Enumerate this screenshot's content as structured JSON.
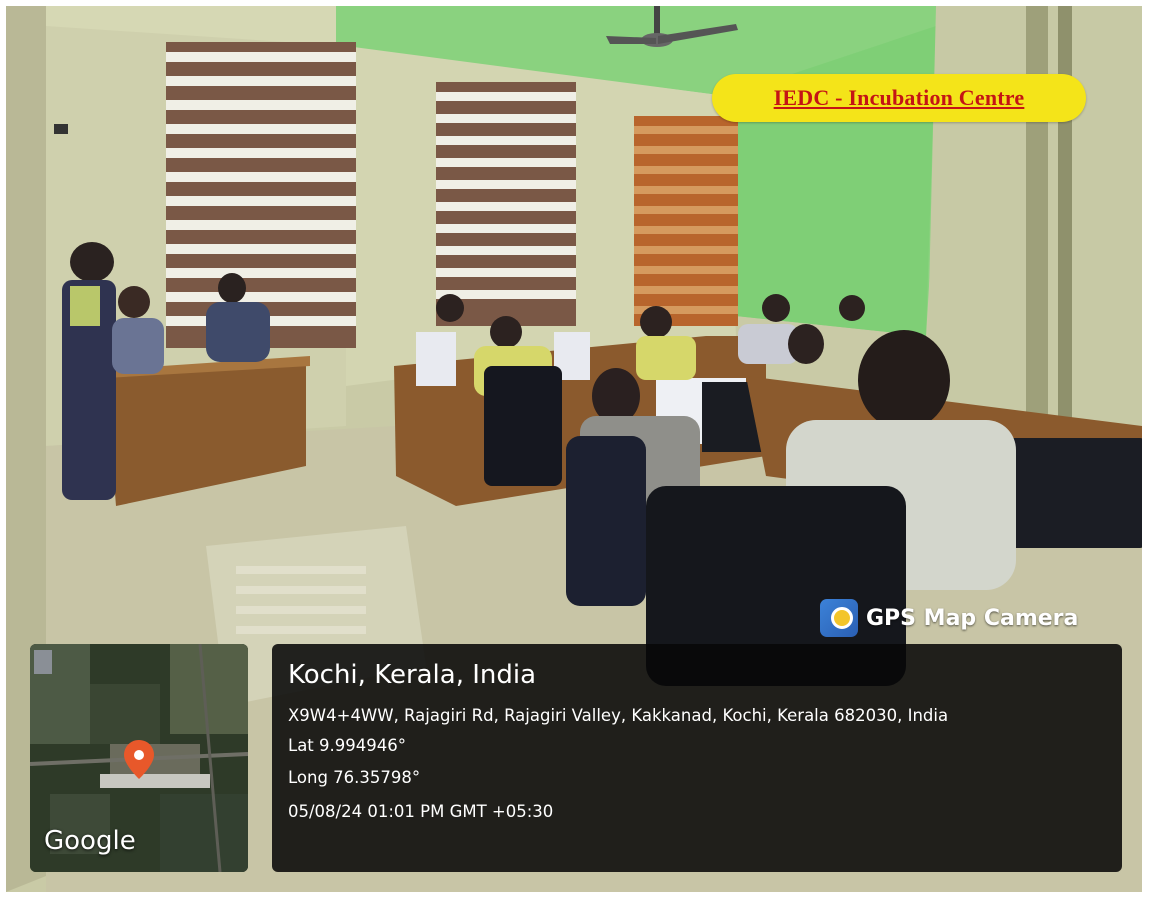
{
  "banner": {
    "text": "IEDC - Incubation Centre"
  },
  "gps_app": {
    "name": "GPS Map Camera",
    "icon": "map-pin-app-icon"
  },
  "map": {
    "provider": "Google",
    "marker_color": "#e8582a"
  },
  "location": {
    "city": "Kochi, Kerala, India",
    "address": "X9W4+4WW, Rajagiri Rd, Rajagiri Valley, Kakkanad, Kochi, Kerala 682030, India",
    "lat": "Lat 9.994946°",
    "long": "Long 76.35798°",
    "datetime": "05/08/24 01:01 PM GMT +05:30"
  },
  "colors": {
    "banner_bg": "#f4e419",
    "banner_text": "#c41515",
    "wall_green": "#7fd07a"
  }
}
